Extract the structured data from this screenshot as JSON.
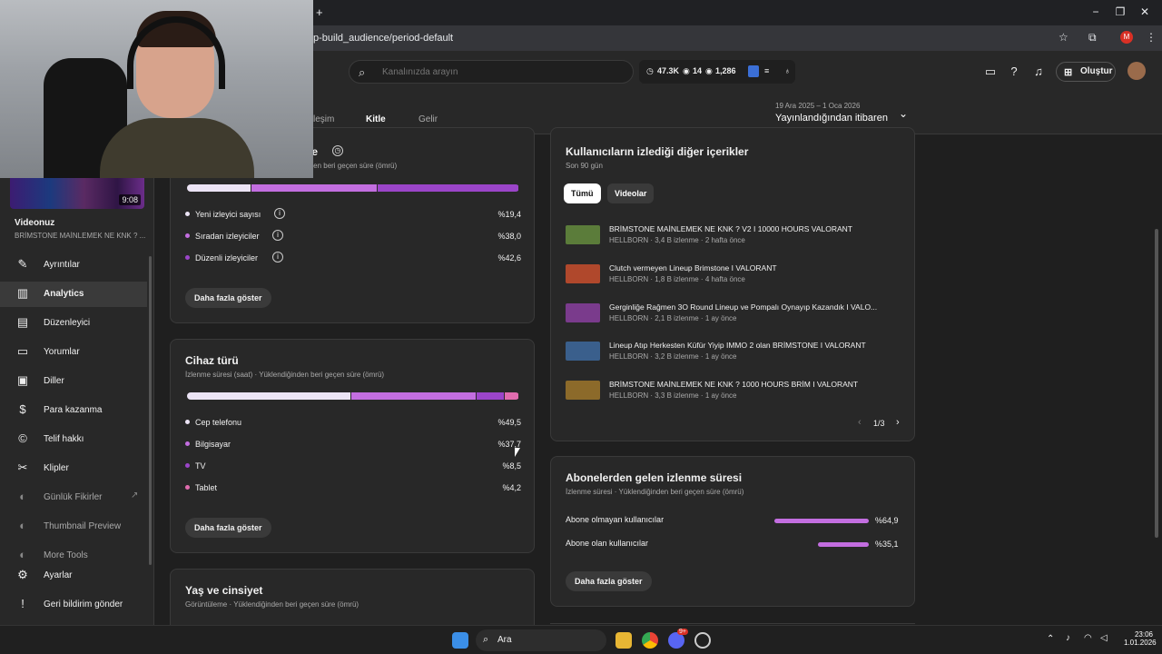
{
  "browser": {
    "url": "p-build_audience/period-default",
    "new_tab_glyph": "+",
    "profile_initial": "M"
  },
  "header": {
    "search_placeholder": "Kanalınızda arayın",
    "stats": {
      "views": "47.3K",
      "eye_count": "14",
      "third": "1,286"
    },
    "create_label": "Oluştur"
  },
  "tabs": [
    {
      "label": "leşim"
    },
    {
      "label": "Kitle",
      "active": true
    },
    {
      "label": "Gelir"
    }
  ],
  "period": {
    "range": "19 Ara 2025 – 1 Oca 2026",
    "label": "Yayınlandığından itibaren"
  },
  "sidebar": {
    "video_duration": "9:08",
    "video_section_label": "Videonuz",
    "video_title": "BRİMSTONE MAİNLEMEK NE KNK ? ...",
    "items": [
      {
        "label": "Ayrıntılar",
        "icon": "pencil-icon",
        "glyph": "✎"
      },
      {
        "label": "Analytics",
        "icon": "chart-icon",
        "glyph": "▥",
        "active": true
      },
      {
        "label": "Düzenleyici",
        "icon": "editor-icon",
        "glyph": "▤"
      },
      {
        "label": "Yorumlar",
        "icon": "comment-icon",
        "glyph": "▭"
      },
      {
        "label": "Diller",
        "icon": "subtitles-icon",
        "glyph": "▣"
      },
      {
        "label": "Para kazanma",
        "icon": "dollar-icon",
        "glyph": "$"
      },
      {
        "label": "Telif hakkı",
        "icon": "copyright-icon",
        "glyph": "©"
      },
      {
        "label": "Klipler",
        "icon": "scissors-icon",
        "glyph": "✂"
      },
      {
        "label": "Günlük Fikirler",
        "icon": "extension-icon",
        "glyph": "◐"
      },
      {
        "label": "Thumbnail Preview",
        "icon": "extension-icon",
        "glyph": "◐"
      },
      {
        "label": "More Tools",
        "icon": "extension-icon",
        "glyph": "◐"
      },
      {
        "label": "Ayarlar",
        "icon": "gear-icon",
        "glyph": "⚙"
      },
      {
        "label": "Geri bildirim gönder",
        "icon": "feedback-icon",
        "glyph": "!"
      }
    ]
  },
  "viewers_card": {
    "title_tail": "le",
    "subtitle_tail": "ğinden beri geçen süre (ömrü)",
    "rows": [
      {
        "label": "Yeni izleyici sayısı",
        "value": "%19,4",
        "pct": 19.4,
        "color": "#ece4f5"
      },
      {
        "label": "Sıradan izleyiciler",
        "value": "%38,0",
        "pct": 38.0,
        "color": "#c36ee0"
      },
      {
        "label": "Düzenli izleyiciler",
        "value": "%42,6",
        "pct": 42.6,
        "color": "#9b45c9"
      }
    ],
    "more": "Daha fazla göster"
  },
  "device_card": {
    "title": "Cihaz türü",
    "subtitle": "İzlenme süresi (saat) · Yüklendiğinden beri geçen süre (ömrü)",
    "rows": [
      {
        "label": "Cep telefonu",
        "value": "%49,5",
        "pct": 49.5,
        "color": "#ece4f5"
      },
      {
        "label": "Bilgisayar",
        "value": "%37,7",
        "pct": 37.7,
        "color": "#c36ee0"
      },
      {
        "label": "TV",
        "value": "%8,5",
        "pct": 8.5,
        "color": "#9b45c9"
      },
      {
        "label": "Tablet",
        "value": "%4,2",
        "pct": 4.2,
        "color": "#e06cae"
      }
    ],
    "more": "Daha fazla göster"
  },
  "age_card": {
    "title": "Yaş ve cinsiyet",
    "subtitle": "Görüntüleme · Yüklendiğinden beri geçen süre (ömrü)"
  },
  "other_content": {
    "title": "Kullanıcıların izlediği diğer içerikler",
    "subtitle": "Son 90 gün",
    "filters": [
      "Tümü",
      "Videolar"
    ],
    "videos": [
      {
        "title": "BRİMSTONE MAİNLEMEK NE KNK ? V2 I 10000 HOURS VALORANT",
        "meta": "HELLBORN · 3,4 B izlenme · 2 hafta önce",
        "color": "#5b7c3a"
      },
      {
        "title": "Clutch vermeyen Lineup Brimstone I VALORANT",
        "meta": "HELLBORN · 1,8 B izlenme · 4 hafta önce",
        "color": "#b0482c"
      },
      {
        "title": "Gerginliğe Rağmen 3O Round Lineup ve Pompalı Oynayıp Kazandık I VALO...",
        "meta": "HELLBORN · 2,1 B izlenme · 1 ay önce",
        "color": "#7a3b8c"
      },
      {
        "title": "Lineup Atıp Herkesten Küfür Yiyip IMMO 2 olan BRİMSTONE I VALORANT",
        "meta": "HELLBORN · 3,2 B izlenme · 1 ay önce",
        "color": "#3a5f8c"
      },
      {
        "title": "BRİMSTONE MAİNLEMEK NE KNK ? 1000 HOURS BRİM I VALORANT",
        "meta": "HELLBORN · 3,3 B izlenme · 1 ay önce",
        "color": "#8c6a2a"
      }
    ],
    "pagination": "1/3"
  },
  "subscriber_card": {
    "title": "Abonelerden gelen izlenme süresi",
    "subtitle": "İzlenme süresi · Yüklendiğinden beri geçen süre (ömrü)",
    "rows": [
      {
        "label": "Abone olmayan kullanıcılar",
        "value": "%64,9",
        "pct": 64.9
      },
      {
        "label": "Abone olan kullanıcılar",
        "value": "%35,1",
        "pct": 35.1
      }
    ],
    "more": "Daha fazla göster"
  },
  "taskbar": {
    "search": "Ara",
    "time": "23:06",
    "date": "1.01.2026",
    "badge": "9+"
  }
}
